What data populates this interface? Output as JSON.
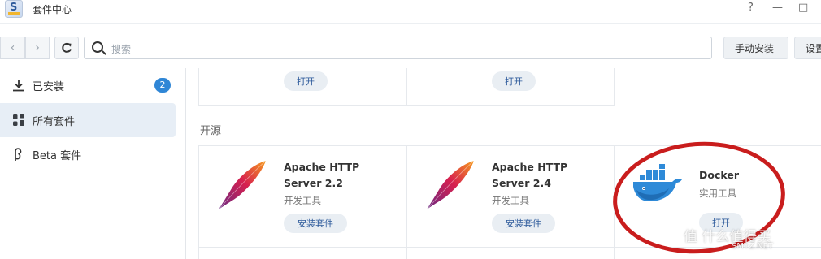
{
  "window": {
    "title": "套件中心",
    "help": "?",
    "minimize": "—",
    "maximize": "□"
  },
  "toolbar": {
    "search_placeholder": "搜索",
    "manual_install_label": "手动安装",
    "settings_label": "设置"
  },
  "sidebar": {
    "items": [
      {
        "label": "已安装",
        "badge": "2",
        "icon": "download-icon"
      },
      {
        "label": "所有套件",
        "icon": "grid-icon",
        "active": true
      },
      {
        "label": "Beta 套件",
        "icon": "beta-icon"
      }
    ]
  },
  "top_row": {
    "open_label_1": "打开",
    "open_label_2": "打开"
  },
  "section": {
    "title": "开源"
  },
  "packages": [
    {
      "name_line1": "Apache HTTP",
      "name_line2": "Server 2.2",
      "category": "开发工具",
      "action": "安装套件",
      "icon": "apache-feather-icon"
    },
    {
      "name_line1": "Apache HTTP",
      "name_line2": "Server 2.4",
      "category": "开发工具",
      "action": "安装套件",
      "icon": "apache-feather-icon"
    },
    {
      "name_line1": "Docker",
      "category": "实用工具",
      "action": "打开",
      "icon": "docker-whale-icon"
    }
  ],
  "watermark": {
    "line1": "值 什么值得买",
    "line2": "SMYZ.NET"
  },
  "colors": {
    "accent": "#2f86d6",
    "highlight_circle": "#c91d1d"
  }
}
